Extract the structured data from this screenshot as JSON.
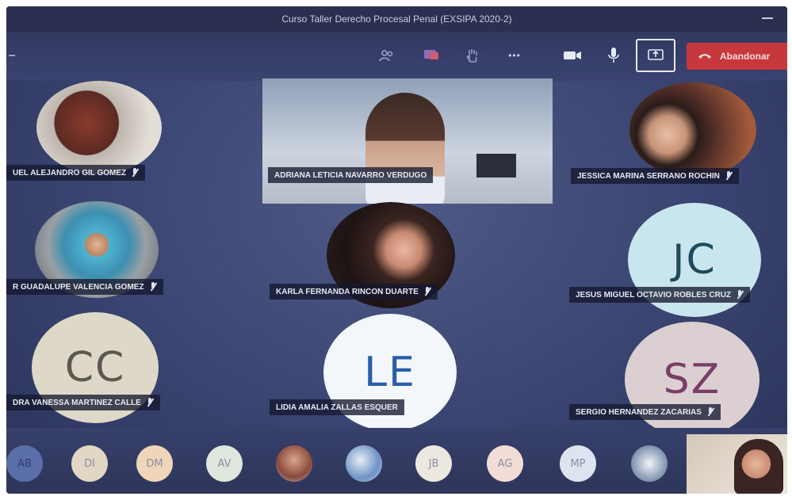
{
  "window": {
    "title": "Curso Taller Derecho Procesal Penal (EXSIPA 2020-2)"
  },
  "toolbar": {
    "more_label": "•••",
    "leave_label": "Abandonar"
  },
  "participants": {
    "p1": {
      "name": "UEL ALEJANDRO GIL GOMEZ"
    },
    "p2": {
      "name": "ADRIANA LETICIA NAVARRO VERDUGO"
    },
    "p3": {
      "name": "JESSICA MARINA SERRANO ROCHIN"
    },
    "p4": {
      "name": "R GUADALUPE VALENCIA GOMEZ"
    },
    "p5": {
      "name": "KARLA FERNANDA RINCON DUARTE"
    },
    "p6": {
      "name": "JESUS MIGUEL OCTAVIO ROBLES CRUZ",
      "initials": "JC"
    },
    "p7": {
      "name": "DRA VANESSA MARTINEZ CALLE",
      "initials": "CC"
    },
    "p8": {
      "name": "LIDIA AMALIA ZALLAS ESQUER",
      "initials": "LE"
    },
    "p9": {
      "name": "SERGIO HERNANDEZ ZACARIAS",
      "initials": "SZ"
    }
  },
  "roster": {
    "a1": "AB",
    "a2": "DI",
    "a3": "DM",
    "a4": "AV",
    "a7": "JB",
    "a8": "AG",
    "a9": "MP"
  },
  "colors": {
    "jc_bg": "#c9e6ee",
    "jc_fg": "#1f4a5a",
    "cc_bg": "#ddd8c7",
    "cc_fg": "#5a5850",
    "le_bg": "#f3f6fb",
    "le_fg": "#2a5ea8",
    "sz_bg": "#dccfd2",
    "sz_fg": "#7a3e66",
    "leave": "#c7383c"
  }
}
